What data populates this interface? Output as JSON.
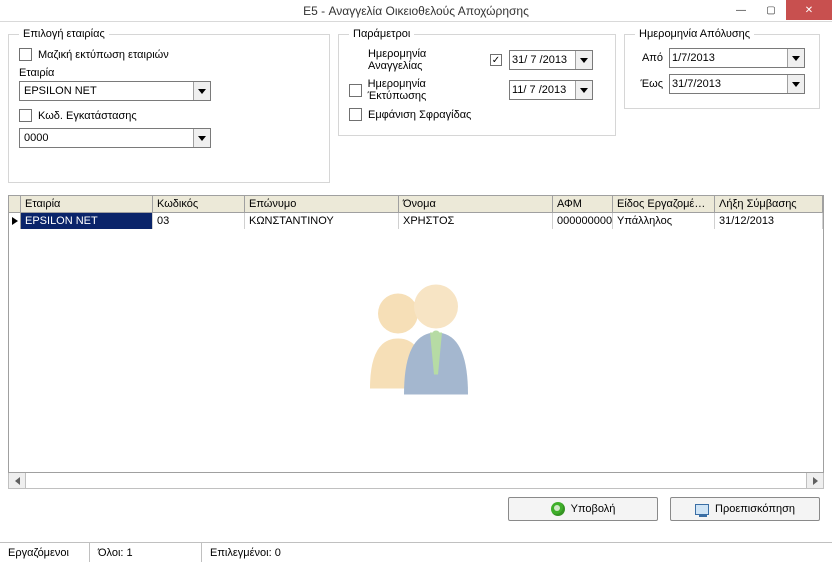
{
  "window": {
    "title": "E5 - Αναγγελία Οικειοθελούς Αποχώρησης"
  },
  "company_group": {
    "legend": "Επιλογή εταιρίας",
    "mass_print_label": "Μαζική εκτύπωση εταιριών",
    "company_label": "Εταιρία",
    "company_value": "EPSILON NET",
    "branch_code_label": "Κωδ. Εγκατάστασης",
    "branch_code_value": "0000"
  },
  "params_group": {
    "legend": "Παράμετροι",
    "announce_date_label": "Ημερομηνία Αναγγελίας",
    "announce_date_value": "31/ 7 /2013",
    "print_date_label": "Ημερομηνία Έκτύπωσης",
    "print_date_value": "11/ 7 /2013",
    "show_stamp_label": "Εμφάνιση Σφραγίδας"
  },
  "dismissal_group": {
    "legend": "Ημερομηνία Απόλυσης",
    "from_label": "Από",
    "from_value": "1/7/2013",
    "to_label": "Έως",
    "to_value": "31/7/2013"
  },
  "grid": {
    "columns": [
      "Εταιρία",
      "Κωδικός",
      "Επώνυμο",
      "Όνομα",
      "ΑΦΜ",
      "Είδος Εργαζομένου",
      "Λήξη Σύμβασης"
    ],
    "rows": [
      {
        "company": "EPSILON NET",
        "code": "03",
        "surname": "ΚΩΝΣΤΑΝΤΙΝΟΥ",
        "name": "ΧΡΗΣΤΟΣ",
        "afm": "000000000",
        "type": "Υπάλληλος",
        "contract_end": "31/12/2013",
        "selected": true
      }
    ]
  },
  "buttons": {
    "submit": "Υποβολή",
    "preview": "Προεπισκόπηση"
  },
  "status": {
    "employees_label": "Εργαζόμενοι",
    "total_label": "Όλοι:",
    "total_value": "1",
    "selected_label": "Επιλεγμένοι:",
    "selected_value": "0"
  }
}
